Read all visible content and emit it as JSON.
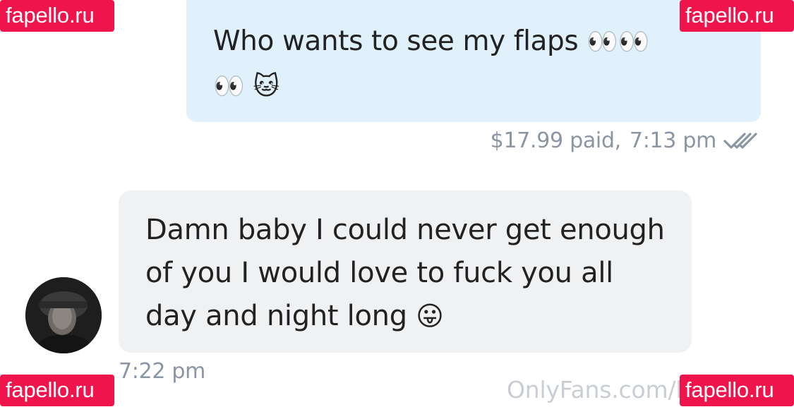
{
  "conversation": {
    "outgoing": {
      "text_line1": "Who wants to see my flaps",
      "text_line2": "",
      "emoji_eyes": "👀👀",
      "emoji_eyes2": "👀",
      "emoji_cat": "🐱",
      "price": "$17.99 paid,",
      "time": "7:13 pm",
      "status_icon": "double-check-icon"
    },
    "incoming": {
      "text": "Damn baby I could never get enough of you I would love to fuck you all day and night long",
      "emoji": "😛",
      "time": "7:22 pm",
      "avatar": "user-avatar"
    }
  },
  "watermarks": {
    "site": "fapello.ru",
    "source": "OnlyFans.com/l"
  },
  "colors": {
    "outgoing_bubble": "#e0f1fb",
    "incoming_bubble": "#f0f1f3",
    "meta_text": "#8a96a3",
    "badge": "#f0144c"
  }
}
